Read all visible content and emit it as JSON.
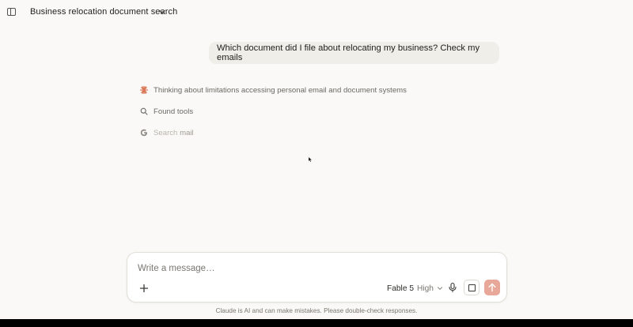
{
  "header": {
    "conversation_title": "Business relocation document search"
  },
  "chat": {
    "user_message": "Which document did I file about relocating my business? Check my emails",
    "steps": [
      {
        "icon": "sparkle-icon",
        "text": "Thinking about limitations accessing personal email and document systems"
      },
      {
        "icon": "search-icon",
        "text": "Found tools"
      },
      {
        "icon": "google-icon",
        "text_prefix": "Search",
        "text_suffix": "mail"
      }
    ]
  },
  "composer": {
    "placeholder": "Write a message…",
    "model_name": "Fable 5",
    "model_effort": "High"
  },
  "footer": {
    "disclaimer": "Claude is AI and can make mistakes. Please double-check responses."
  },
  "colors": {
    "page_bg": "#faf9f7",
    "bubble_bg": "#f0eee9",
    "send_button": "#e8a899",
    "sparkle": "#d97757"
  }
}
